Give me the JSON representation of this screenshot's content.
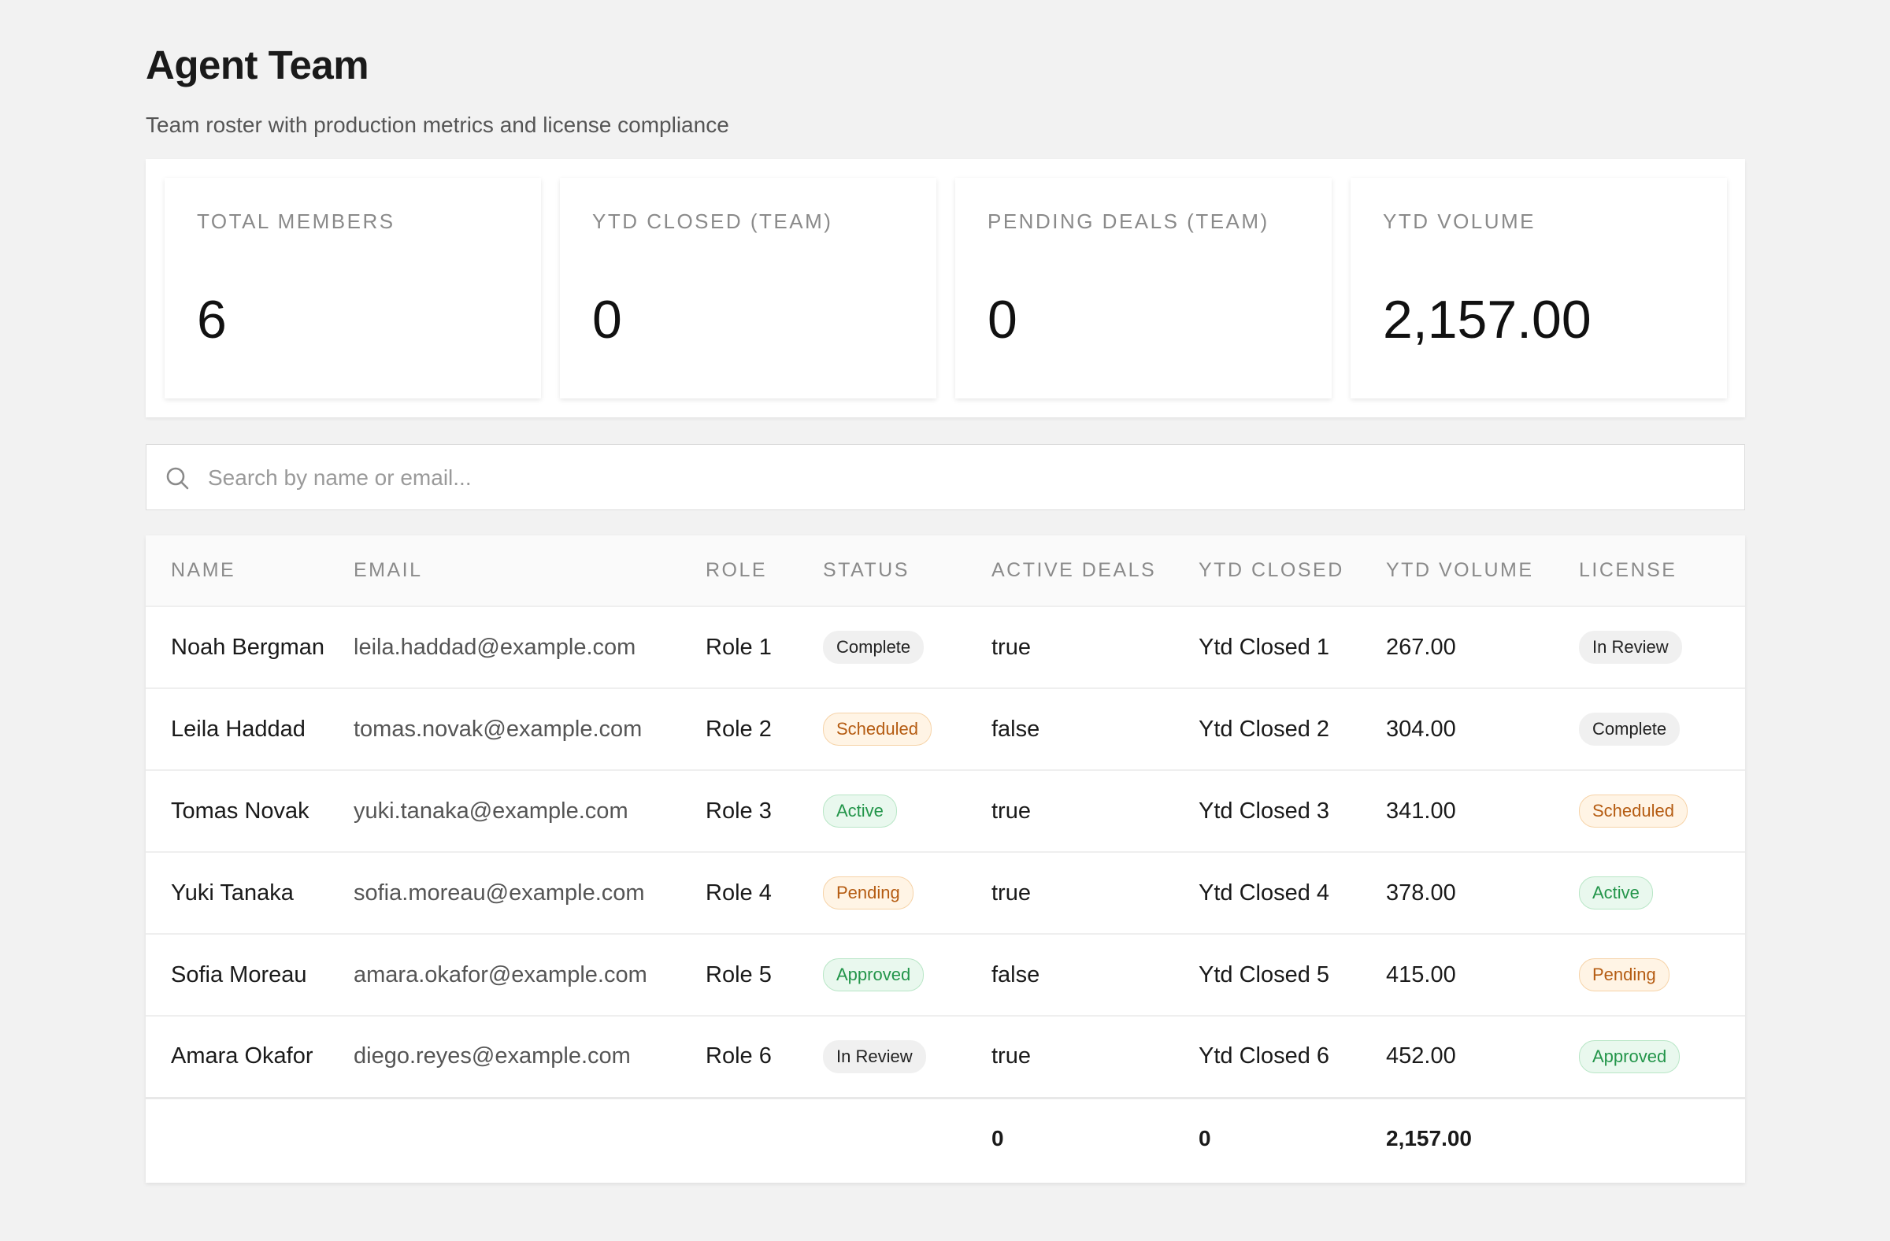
{
  "page": {
    "title": "Agent Team",
    "subtitle": "Team roster with production metrics and license compliance"
  },
  "stats": [
    {
      "label": "TOTAL MEMBERS",
      "value": "6"
    },
    {
      "label": "YTD CLOSED (TEAM)",
      "value": "0"
    },
    {
      "label": "PENDING DEALS (TEAM)",
      "value": "0"
    },
    {
      "label": "YTD VOLUME",
      "value": "2,157.00"
    }
  ],
  "search": {
    "placeholder": "Search by name or email...",
    "icon": "search-icon"
  },
  "table": {
    "columns": [
      "NAME",
      "EMAIL",
      "ROLE",
      "STATUS",
      "ACTIVE DEALS",
      "YTD CLOSED",
      "YTD VOLUME",
      "LICENSE"
    ],
    "rows": [
      {
        "name": "Noah Bergman",
        "email": "leila.haddad@example.com",
        "role": "Role 1",
        "status": "Complete",
        "active_deals": "true",
        "ytd_closed": "Ytd Closed 1",
        "ytd_volume": "267.00",
        "license": "In Review"
      },
      {
        "name": "Leila Haddad",
        "email": "tomas.novak@example.com",
        "role": "Role 2",
        "status": "Scheduled",
        "active_deals": "false",
        "ytd_closed": "Ytd Closed 2",
        "ytd_volume": "304.00",
        "license": "Complete"
      },
      {
        "name": "Tomas Novak",
        "email": "yuki.tanaka@example.com",
        "role": "Role 3",
        "status": "Active",
        "active_deals": "true",
        "ytd_closed": "Ytd Closed 3",
        "ytd_volume": "341.00",
        "license": "Scheduled"
      },
      {
        "name": "Yuki Tanaka",
        "email": "sofia.moreau@example.com",
        "role": "Role 4",
        "status": "Pending",
        "active_deals": "true",
        "ytd_closed": "Ytd Closed 4",
        "ytd_volume": "378.00",
        "license": "Active"
      },
      {
        "name": "Sofia Moreau",
        "email": "amara.okafor@example.com",
        "role": "Role 5",
        "status": "Approved",
        "active_deals": "false",
        "ytd_closed": "Ytd Closed 5",
        "ytd_volume": "415.00",
        "license": "Pending"
      },
      {
        "name": "Amara Okafor",
        "email": "diego.reyes@example.com",
        "role": "Role 6",
        "status": "In Review",
        "active_deals": "true",
        "ytd_closed": "Ytd Closed 6",
        "ytd_volume": "452.00",
        "license": "Approved"
      }
    ],
    "footer": {
      "active_deals": "0",
      "ytd_closed": "0",
      "ytd_volume": "2,157.00"
    }
  },
  "badge_colors": {
    "neutral": "#f0f0f0",
    "orange": "#b55c12",
    "green": "#23954a"
  }
}
